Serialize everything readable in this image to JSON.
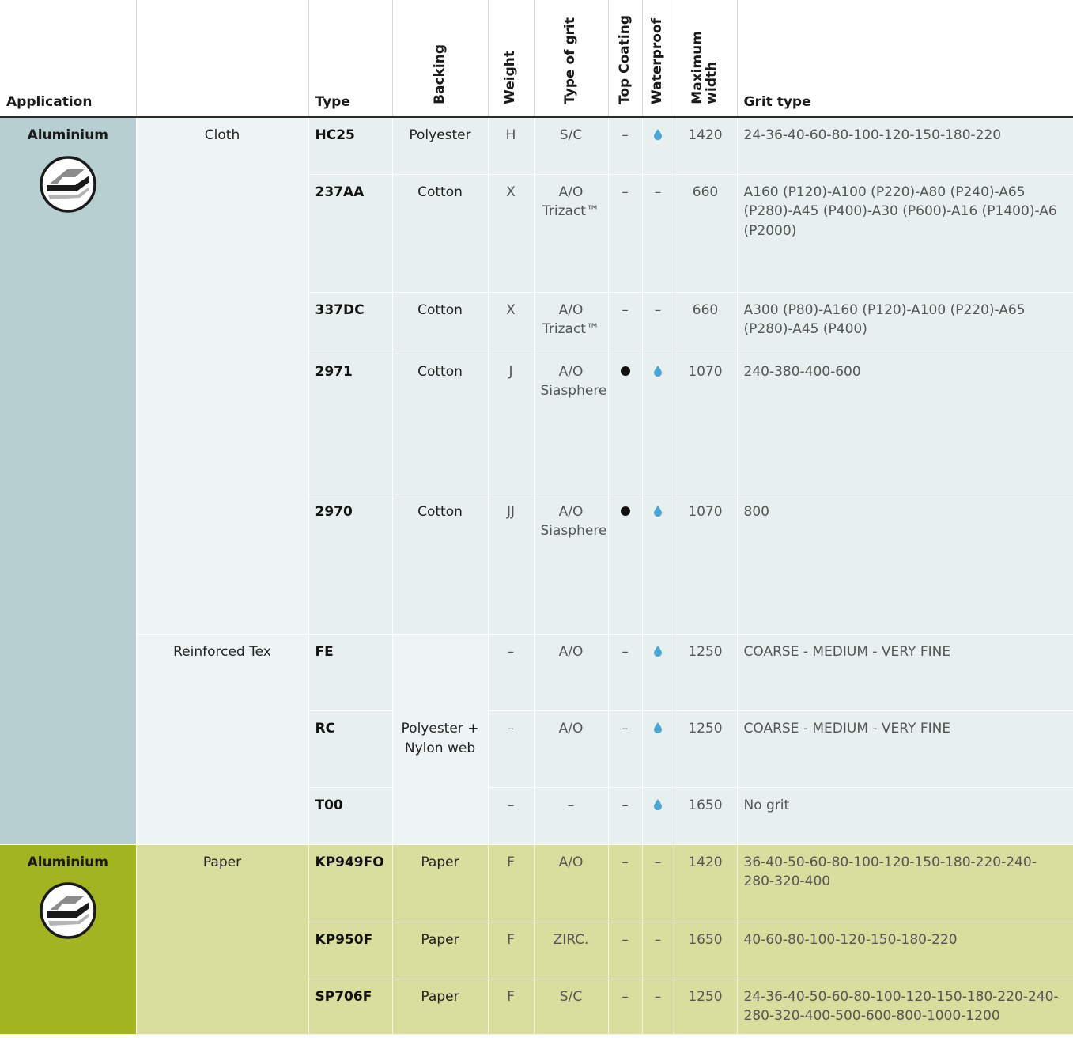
{
  "headers": {
    "application": "Application",
    "type": "Type",
    "backing": "Backing",
    "weight": "Weight",
    "type_of_grit": "Type of grit",
    "top_coating": "Top Coating",
    "waterproof": "Waterproof",
    "maximum_width": "Maximum width",
    "grit_type": "Grit type"
  },
  "colors": {
    "group1_application": "#b7cfd0",
    "group1_rows": "#e7efef",
    "group2_application": "#a2b521",
    "group2_rows": "#d9dd9e",
    "waterproof_drop": "#4aa6d6"
  },
  "groups": [
    {
      "application": "Aluminium",
      "icon": "aluminium-profile-icon",
      "subgroups": [
        {
          "name": "Cloth",
          "rows": [
            {
              "type": "HC25",
              "backing": "Polyester",
              "weight": "H",
              "grit": "S/C",
              "top_coating": "–",
              "waterproof": "drop",
              "max_width": "1420",
              "grit_type": "24-36-40-60-80-100-120-150-180-220"
            },
            {
              "type": "237AA",
              "backing": "Cotton",
              "weight": "X",
              "grit": "A/O Trizact™",
              "top_coating": "–",
              "waterproof": "–",
              "max_width": "660",
              "grit_type": "A160 (P120)-A100 (P220)-A80 (P240)-A65 (P280)-A45 (P400)-A30 (P600)-A16 (P1400)-A6 (P2000)"
            },
            {
              "type": "337DC",
              "backing": "Cotton",
              "weight": "X",
              "grit": "A/O Trizact™",
              "top_coating": "–",
              "waterproof": "–",
              "max_width": "660",
              "grit_type": "A300 (P80)-A160 (P120)-A100 (P220)-A65 (P280)-A45 (P400)"
            },
            {
              "type": "2971",
              "backing": "Cotton",
              "weight": "J",
              "grit": "A/O Siasphere",
              "top_coating": "dot",
              "waterproof": "drop",
              "max_width": "1070",
              "grit_type": "240-380-400-600"
            },
            {
              "type": "2970",
              "backing": "Cotton",
              "weight": "JJ",
              "grit": "A/O Siasphere",
              "top_coating": "dot",
              "waterproof": "drop",
              "max_width": "1070",
              "grit_type": "800"
            }
          ]
        },
        {
          "name": "Reinforced Tex",
          "backing": "Polyester + Nylon web",
          "rows": [
            {
              "type": "FE",
              "weight": "–",
              "grit": "A/O",
              "top_coating": "–",
              "waterproof": "drop",
              "max_width": "1250",
              "grit_type": "COARSE - MEDIUM - VERY FINE"
            },
            {
              "type": "RC",
              "weight": "–",
              "grit": "A/O",
              "top_coating": "–",
              "waterproof": "drop",
              "max_width": "1250",
              "grit_type": "COARSE - MEDIUM - VERY FINE"
            },
            {
              "type": "T00",
              "weight": "–",
              "grit": "–",
              "top_coating": "–",
              "waterproof": "drop",
              "max_width": "1650",
              "grit_type": "No grit"
            }
          ]
        }
      ]
    },
    {
      "application": "Aluminium",
      "icon": "aluminium-profile-icon",
      "subgroups": [
        {
          "name": "Paper",
          "rows": [
            {
              "type": "KP949FO",
              "backing": "Paper",
              "weight": "F",
              "grit": "A/O",
              "top_coating": "–",
              "waterproof": "–",
              "max_width": "1420",
              "grit_type": "36-40-50-60-80-100-120-150-180-220-240-280-320-400"
            },
            {
              "type": "KP950F",
              "backing": "Paper",
              "weight": "F",
              "grit": "ZIRC.",
              "top_coating": "–",
              "waterproof": "–",
              "max_width": "1650",
              "grit_type": "40-60-80-100-120-150-180-220"
            },
            {
              "type": "SP706F",
              "backing": "Paper",
              "weight": "F",
              "grit": "S/C",
              "top_coating": "–",
              "waterproof": "–",
              "max_width": "1250",
              "grit_type": "24-36-40-50-60-80-100-120-150-180-220-240-280-320-400-500-600-800-1000-1200"
            }
          ]
        }
      ]
    }
  ]
}
